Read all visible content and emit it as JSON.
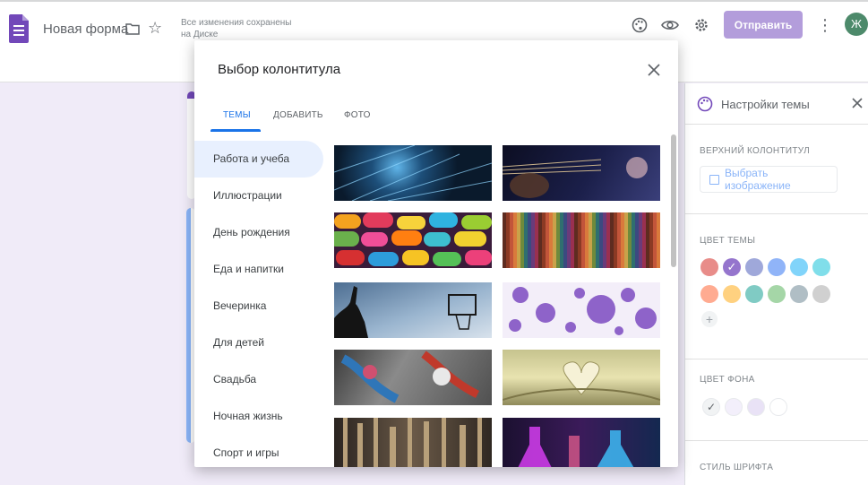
{
  "topbar": {
    "form_title": "Новая форма",
    "save_status": "Все изменения сохранены на Диске",
    "send_label": "Отправить",
    "avatar_letter": "Ж",
    "icons": [
      "forms-doc-icon",
      "folder-icon",
      "star-icon",
      "palette-icon",
      "eye-icon",
      "gear-icon",
      "more-vert-icon"
    ]
  },
  "theme_panel": {
    "title": "Настройки темы",
    "header_label": "ВЕРХНИЙ КОЛОНТИТУЛ",
    "select_image_label": "Выбрать изображение",
    "theme_color_label": "ЦВЕТ ТЕМЫ",
    "bg_color_label": "ЦВЕТ ФОНА",
    "font_style_label": "СТИЛЬ ШРИФТА",
    "add_color_symbol": "+",
    "theme_colors": [
      "#e88c89",
      "#9575cd",
      "#9fa8da",
      "#90b4f8",
      "#81d4fa",
      "#80deea",
      "#ffab91",
      "#ffd180",
      "#80cbc4",
      "#a5d6a7",
      "#b0bec5",
      "#d0d0d0"
    ],
    "theme_color_selected": 1,
    "bg_colors": [
      "#f1f3f4",
      "#f3effb",
      "#e9e2f6",
      "#ffffff"
    ],
    "bg_color_selected": 0
  },
  "dialog": {
    "title": "Выбор колонтитула",
    "tabs": [
      {
        "label": "ТЕМЫ",
        "active": true
      },
      {
        "label": "ДОБАВИТЬ",
        "active": false
      },
      {
        "label": "ФОТО",
        "active": false
      }
    ],
    "categories": [
      {
        "label": "Работа и учеба",
        "active": true
      },
      {
        "label": "Иллюстрации",
        "active": false
      },
      {
        "label": "День рождения",
        "active": false
      },
      {
        "label": "Еда и напитки",
        "active": false
      },
      {
        "label": "Вечеринка",
        "active": false
      },
      {
        "label": "Для детей",
        "active": false
      },
      {
        "label": "Свадьба",
        "active": false
      },
      {
        "label": "Ночная жизнь",
        "active": false
      },
      {
        "label": "Спорт и игры",
        "active": false
      }
    ]
  },
  "colors": {
    "accent": "#1a73e8",
    "brand_purple": "#7248b9",
    "send_button": "#b39ddb"
  }
}
